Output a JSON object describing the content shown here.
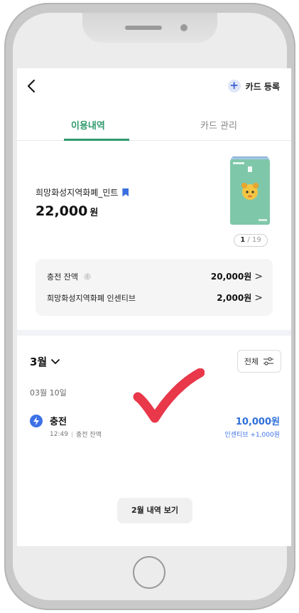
{
  "header": {
    "add_card_label": "카드 등록"
  },
  "tabs": [
    {
      "label": "이용내역",
      "active": true
    },
    {
      "label": "카드 관리",
      "active": false
    }
  ],
  "card": {
    "name": "희망화성지역화폐_민트",
    "balance": "22,000",
    "balance_unit": "원",
    "index": "1",
    "total": "19"
  },
  "info": {
    "charge_label": "충전 잔액",
    "charge_value": "20,000원",
    "incentive_label": "희망화성지역화폐 인센티브",
    "incentive_value": "2,000원"
  },
  "history": {
    "month": "3월",
    "filter_label": "전체",
    "date": "03월 10일",
    "transactions": [
      {
        "title": "충전",
        "time": "12:49",
        "source": "충전 잔액",
        "amount": "10,000원",
        "incentive": "인센티브 +1,000원"
      }
    ],
    "prev_month_label": "2월 내역 보기"
  },
  "colors": {
    "accent_green": "#2f9a6c",
    "accent_blue": "#3d72e6",
    "checkmark_red": "#e8384a",
    "card_mint": "#7fc7a9"
  }
}
